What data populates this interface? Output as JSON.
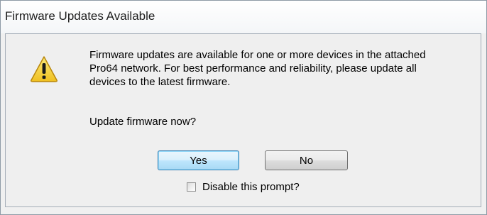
{
  "window": {
    "title": "Firmware Updates Available"
  },
  "dialog": {
    "icon": "warning-icon",
    "message_lines": [
      "Firmware updates are available for one or more devices in the attached",
      "Pro64 network.  For best performance and reliability, please update all",
      "devices to the latest firmware."
    ],
    "question": "Update firmware now?",
    "buttons": {
      "yes": "Yes",
      "no": "No"
    },
    "checkbox": {
      "label": "Disable this prompt?",
      "checked": false
    }
  },
  "colors": {
    "warning_fill": "#f5d030",
    "default_button_border": "#3c7fb1"
  }
}
